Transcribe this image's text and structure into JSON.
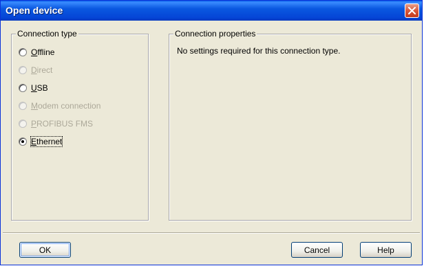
{
  "window": {
    "title": "Open device"
  },
  "connection_type": {
    "legend": "Connection type",
    "options": [
      {
        "pre": "",
        "u": "O",
        "post": "ffline",
        "enabled": true,
        "selected": false
      },
      {
        "pre": "",
        "u": "D",
        "post": "irect",
        "enabled": false,
        "selected": false
      },
      {
        "pre": "",
        "u": "U",
        "post": "SB",
        "enabled": true,
        "selected": false
      },
      {
        "pre": "",
        "u": "M",
        "post": "odem connection",
        "enabled": false,
        "selected": false
      },
      {
        "pre": "",
        "u": "P",
        "post": "ROFIBUS FMS",
        "enabled": false,
        "selected": false
      },
      {
        "pre": "",
        "u": "E",
        "post": "thernet",
        "enabled": true,
        "selected": true
      }
    ]
  },
  "connection_properties": {
    "legend": "Connection properties",
    "message": "No settings required for this connection type."
  },
  "buttons": {
    "ok": "OK",
    "cancel": "Cancel",
    "help": "Help"
  }
}
